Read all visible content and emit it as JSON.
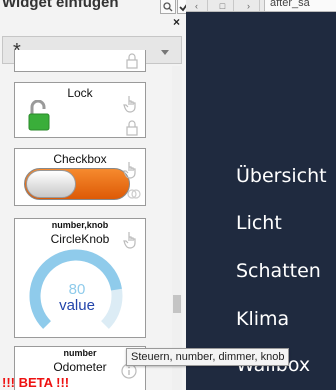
{
  "panel": {
    "title": "Widget einfügen",
    "search_icon": "search-icon",
    "check_icon": "check-icon",
    "close_label": "×",
    "filter": {
      "value": "*"
    }
  },
  "widgets": [
    {
      "title": "Lock"
    },
    {
      "title": "Checkbox"
    },
    {
      "tags": "number,knob",
      "title": "CircleKnob",
      "value": "80",
      "unit": "value",
      "level": 0.8
    },
    {
      "tags": "number",
      "title": "Odometer",
      "beta": "!!! BETA !!!"
    }
  ],
  "browser": {
    "url": "after_sa"
  },
  "nav": {
    "items": [
      "Übersicht",
      "Licht",
      "Schatten",
      "Klima",
      "Wallbox"
    ]
  },
  "tooltip": "Steuern, number, dimmer, knob",
  "colors": {
    "sidebar_bg": "#1f2a3f",
    "knob_fill": "#8fcbeb",
    "beta": "#ee1111",
    "toggle_on": "#ee6a0e",
    "lock_green": "#3aae3a"
  }
}
